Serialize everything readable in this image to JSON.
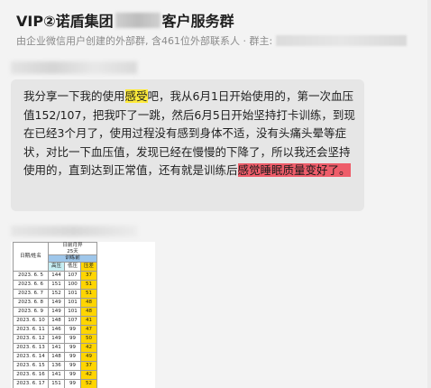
{
  "header": {
    "title_prefix": "VIP②诺盾集团",
    "title_suffix": "客户服务群",
    "subtitle": "由企业微信用户创建的外部群, 含461位外部联系人 · 群主:"
  },
  "message": {
    "text_1": "我分享一下我的使用",
    "highlight_1": "感受",
    "text_2": "吧，我从6月1日开始使用的，第一次血压值152/107，把我吓了一跳，然后6月5日开始坚持打卡训练，到现在已经3个月了，使用过程没有感到身体不适，没有头痛头晕等症状，对比一下血压值，发现已经在慢慢的下降了，所以我还会坚持使用的，直到达到正常值，还有就是训练后",
    "highlight_2": "感觉睡眠质量变好了。"
  },
  "record_image": {
    "date_header": "日期/姓名",
    "plan_header": "日前月异\n25天",
    "section_header": "训练前",
    "col_high": "高压",
    "col_low": "低压",
    "col_diff": "压差",
    "rows": [
      {
        "date": "2023. 6. 5",
        "high": "144",
        "low": "107",
        "diff": "37"
      },
      {
        "date": "2023. 6. 6",
        "high": "151",
        "low": "100",
        "diff": "51"
      },
      {
        "date": "2023. 6. 7",
        "high": "152",
        "low": "101",
        "diff": "51"
      },
      {
        "date": "2023. 6. 8",
        "high": "149",
        "low": "101",
        "diff": "48"
      },
      {
        "date": "2023. 6. 9",
        "high": "149",
        "low": "101",
        "diff": "48"
      },
      {
        "date": "2023. 6. 10",
        "high": "148",
        "low": "107",
        "diff": "41"
      },
      {
        "date": "2023. 6. 11",
        "high": "146",
        "low": "99",
        "diff": "47"
      },
      {
        "date": "2023. 6. 12",
        "high": "149",
        "low": "99",
        "diff": "50"
      },
      {
        "date": "2023. 6. 13",
        "high": "141",
        "low": "99",
        "diff": "42"
      },
      {
        "date": "2023. 6. 14",
        "high": "148",
        "low": "99",
        "diff": "49"
      },
      {
        "date": "2023. 6. 15",
        "high": "136",
        "low": "99",
        "diff": "37"
      },
      {
        "date": "2023. 6. 16",
        "high": "141",
        "low": "99",
        "diff": "42"
      },
      {
        "date": "2023. 6. 17",
        "high": "151",
        "low": "99",
        "diff": "52"
      }
    ]
  }
}
